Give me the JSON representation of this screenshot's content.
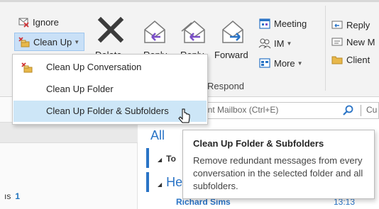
{
  "ribbon": {
    "ignore_label": "Ignore",
    "cleanup_label": "Clean Up",
    "delete_label": "Delete",
    "reply_label": "Reply",
    "reply_all_label": "Reply",
    "forward_label": "Forward",
    "meeting_label": "Meeting",
    "im_label": "IM",
    "more_label": "More",
    "respond_group": "Respond",
    "quickstep_reply": "Reply",
    "quickstep_new": "New M",
    "quickstep_client": "Client"
  },
  "dropdown": {
    "items": [
      {
        "label": "Clean Up Conversation"
      },
      {
        "label": "Clean Up Folder"
      },
      {
        "label": "Clean Up Folder & Subfolders"
      }
    ]
  },
  "search": {
    "placeholder_text": "ent Mailbox (Ctrl+E)",
    "scope": "Cu"
  },
  "list": {
    "tab_all": "All",
    "group1": "To",
    "group2": "He",
    "sender": "Richard Sims",
    "time": "13:13"
  },
  "folders": {
    "item_suffix": "ıs",
    "count": "1"
  },
  "tooltip": {
    "title": "Clean Up Folder & Subfolders",
    "body": "Remove redundant messages from every conversation in the selected folder and all subfolders."
  },
  "colors": {
    "accent": "#2a74c6",
    "hover": "#cde6f7",
    "cleanup_button": "#c9e0f7"
  }
}
